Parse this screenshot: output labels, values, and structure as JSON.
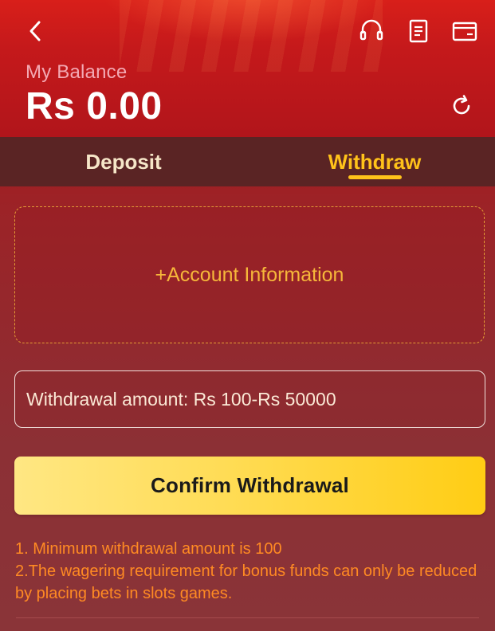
{
  "header": {
    "balance_label": "My Balance",
    "balance_value": "Rs 0.00",
    "icons": [
      "back-arrow-icon",
      "headset-icon",
      "document-icon",
      "wallet-icon",
      "refresh-icon"
    ]
  },
  "tabs": [
    {
      "label": "Deposit",
      "active": false
    },
    {
      "label": "Withdraw",
      "active": true
    }
  ],
  "account": {
    "label": "+Account Information"
  },
  "amount_field": {
    "placeholder": "Withdrawal amount: Rs 100-Rs 50000"
  },
  "confirm": {
    "label": "Confirm Withdrawal"
  },
  "notes": [
    "1. Minimum withdrawal amount is 100",
    "2.The wagering requirement for bonus funds can only be reduced by placing bets in slots games."
  ],
  "colors": {
    "accent": "#ffc21a",
    "header_red": "#c5191b",
    "tab_bar": "#5a2424",
    "note_orange": "#ff8a23"
  }
}
